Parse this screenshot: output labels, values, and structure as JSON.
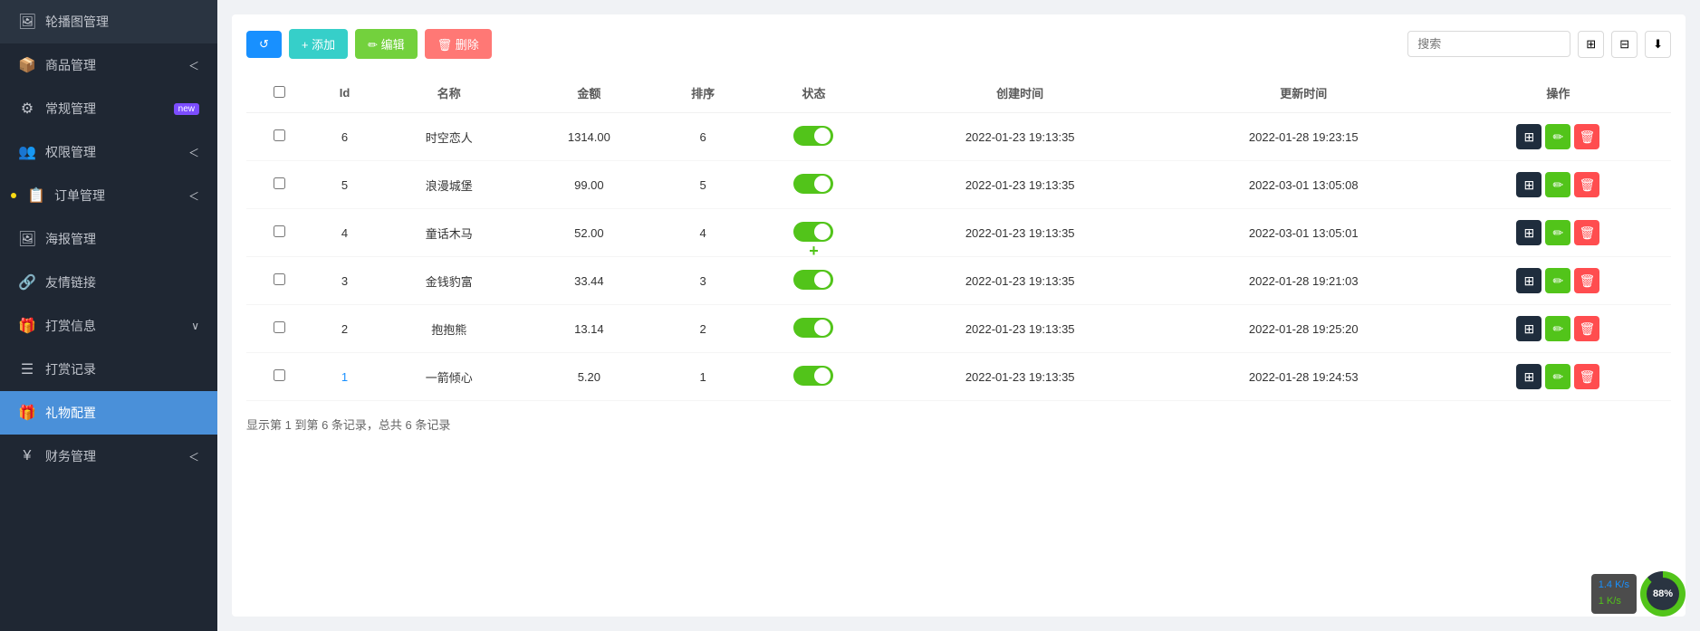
{
  "sidebar": {
    "items": [
      {
        "id": "banner",
        "icon": "🖼",
        "label": "轮播图管理",
        "arrow": false,
        "active": false,
        "dot": false
      },
      {
        "id": "goods",
        "icon": "📦",
        "label": "商品管理",
        "arrow": true,
        "active": false,
        "dot": false
      },
      {
        "id": "general",
        "icon": "⚙",
        "label": "常规管理",
        "arrow": false,
        "active": false,
        "dot": false,
        "badge": "new"
      },
      {
        "id": "auth",
        "icon": "👥",
        "label": "权限管理",
        "arrow": true,
        "active": false,
        "dot": false
      },
      {
        "id": "orders",
        "icon": "📋",
        "label": "订单管理",
        "arrow": true,
        "active": false,
        "dot": true
      },
      {
        "id": "poster",
        "icon": "🖼",
        "label": "海报管理",
        "arrow": false,
        "active": false,
        "dot": false
      },
      {
        "id": "links",
        "icon": "🔗",
        "label": "友情链接",
        "arrow": false,
        "active": false,
        "dot": false
      },
      {
        "id": "reward-info",
        "icon": "🎁",
        "label": "打赏信息",
        "arrow": true,
        "active": false,
        "dot": false
      },
      {
        "id": "reward-log",
        "icon": "☰",
        "label": "打赏记录",
        "arrow": false,
        "active": false,
        "dot": false
      },
      {
        "id": "gift-config",
        "icon": "🎁",
        "label": "礼物配置",
        "arrow": false,
        "active": true,
        "dot": false
      },
      {
        "id": "finance",
        "icon": "¥",
        "label": "财务管理",
        "arrow": true,
        "active": false,
        "dot": false
      }
    ]
  },
  "toolbar": {
    "refresh_label": "↺",
    "add_label": "+ 添加",
    "edit_label": "✏ 编辑",
    "delete_label": "🗑 删除",
    "search_placeholder": "搜索"
  },
  "table": {
    "columns": [
      "",
      "Id",
      "名称",
      "金额",
      "排序",
      "状态",
      "创建时间",
      "更新时间",
      "操作"
    ],
    "rows": [
      {
        "id": 6,
        "name": "时空恋人",
        "amount": "1314.00",
        "order": 6,
        "status": true,
        "created": "2022-01-23 19:13:35",
        "updated": "2022-01-28 19:23:15"
      },
      {
        "id": 5,
        "name": "浪漫城堡",
        "amount": "99.00",
        "order": 5,
        "status": true,
        "created": "2022-01-23 19:13:35",
        "updated": "2022-03-01 13:05:08"
      },
      {
        "id": 4,
        "name": "童话木马",
        "amount": "52.00",
        "order": 4,
        "status": true,
        "created": "2022-01-23 19:13:35",
        "updated": "2022-03-01 13:05:01"
      },
      {
        "id": 3,
        "name": "金钱豹富",
        "amount": "33.44",
        "order": 3,
        "status": true,
        "created": "2022-01-23 19:13:35",
        "updated": "2022-01-28 19:21:03"
      },
      {
        "id": 2,
        "name": "抱抱熊",
        "amount": "13.14",
        "order": 2,
        "status": true,
        "created": "2022-01-23 19:13:35",
        "updated": "2022-01-28 19:25:20"
      },
      {
        "id": 1,
        "name": "一箭倾心",
        "amount": "5.20",
        "order": 1,
        "status": true,
        "created": "2022-01-23 19:13:35",
        "updated": "2022-01-28 19:24:53"
      }
    ]
  },
  "pagination": {
    "text": "显示第 1 到第 6 条记录，总共 6 条记录"
  },
  "network": {
    "upload": "1 K/s",
    "download": "1.4 K/s",
    "percent": "88%"
  }
}
